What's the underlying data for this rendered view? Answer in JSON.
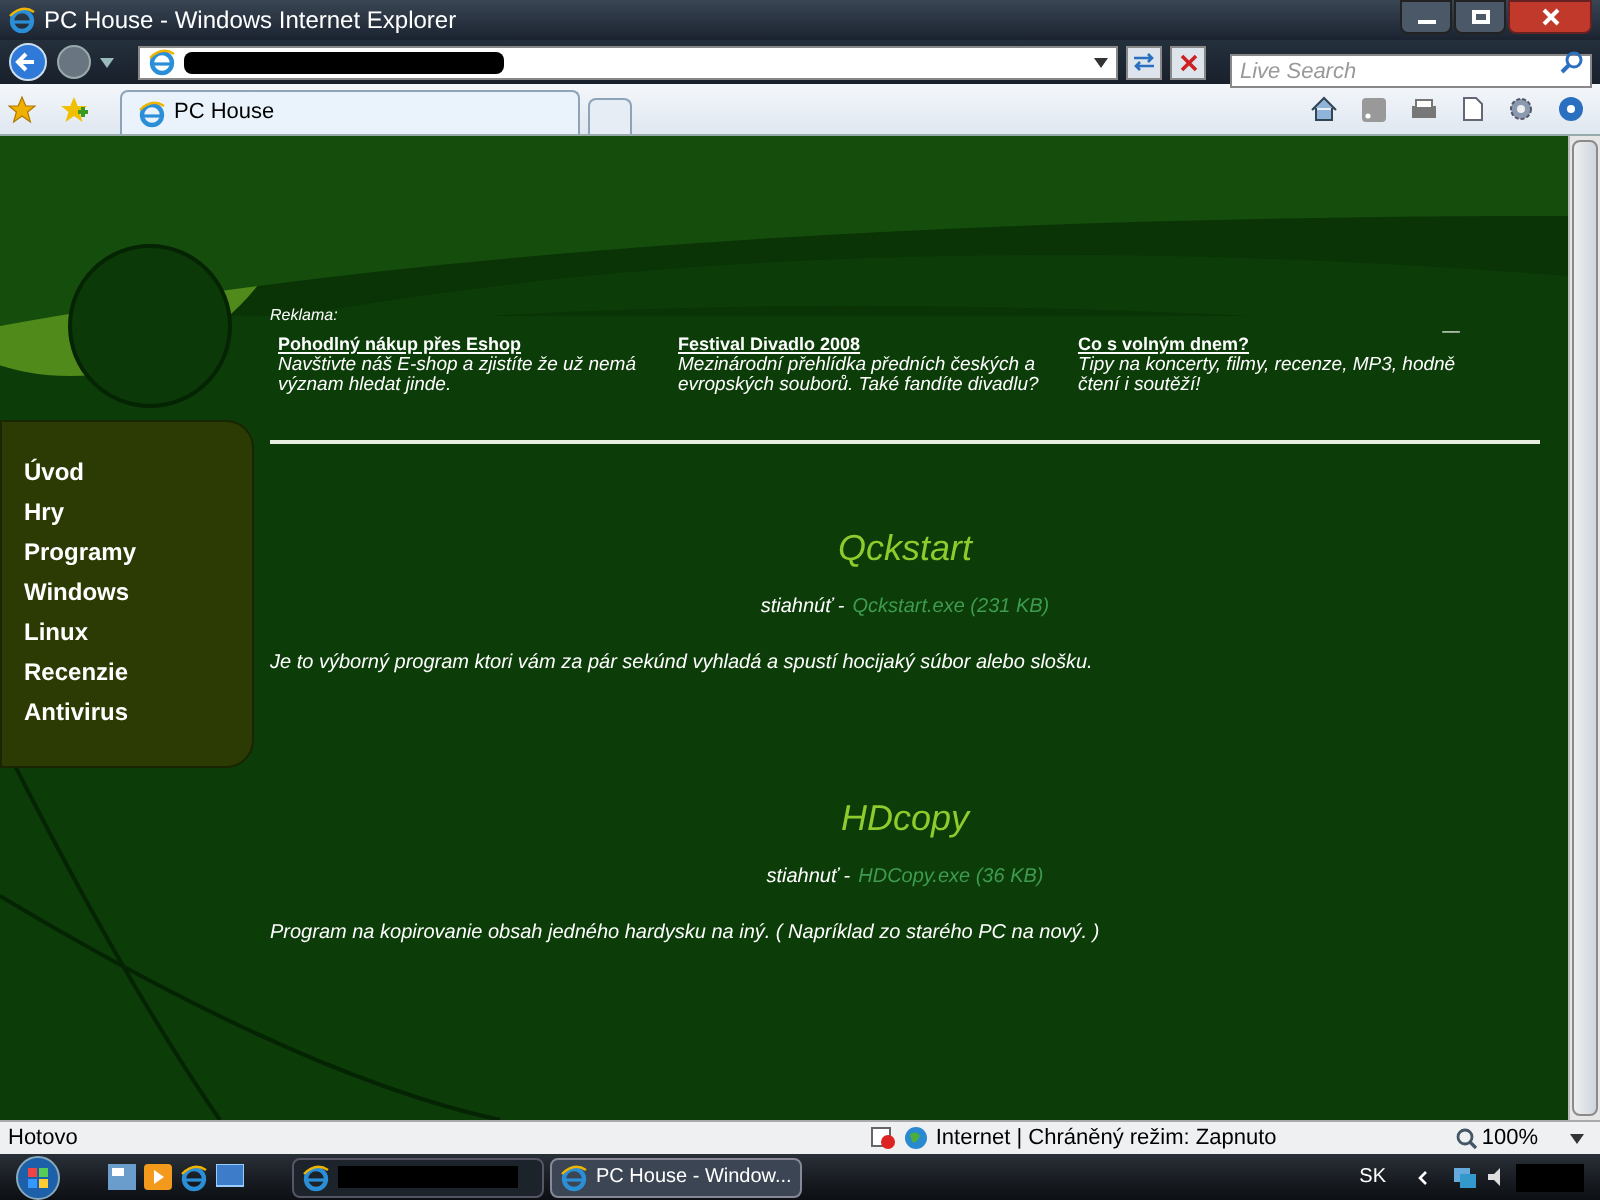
{
  "window": {
    "title": "PC House - Windows Internet Explorer"
  },
  "search": {
    "placeholder": "Live Search"
  },
  "tabs": [
    {
      "label": "PC House",
      "selected": true
    }
  ],
  "ads": {
    "label": "Reklama:",
    "mark": "––",
    "items": [
      {
        "title": "Pohodlný nákup přes Eshop",
        "text": "Navštivte náš E-shop a zjistíte že už nemá význam hledat jinde."
      },
      {
        "title": "Festival Divadlo 2008",
        "text": "Mezinárodní přehlídka předních českých a evropských souborů. Také fandíte divadlu?"
      },
      {
        "title": "Co s volným dnem?",
        "text": "Tipy na koncerty, filmy, recenze, MP3, hodně čtení i soutěží!"
      }
    ]
  },
  "nav": [
    {
      "label": "Úvod"
    },
    {
      "label": "Hry"
    },
    {
      "label": "Programy"
    },
    {
      "label": "Windows"
    },
    {
      "label": "Linux"
    },
    {
      "label": "Recenzie"
    },
    {
      "label": "Antivirus"
    }
  ],
  "programs": [
    {
      "name": "Qckstart",
      "download_label": "stiahnúť -",
      "link": "Qckstart.exe (231 KB)",
      "description": "Je to výborný program ktori vám za pár sekúnd vyhladá a spustí hocijaký súbor alebo slošku."
    },
    {
      "name": "HDcopy",
      "download_label": "stiahnuť -",
      "link": "HDCopy.exe (36 KB)",
      "description": "Program na kopirovanie obsah jedného hardysku na iný. ( Napríklad zo starého PC na nový. )"
    }
  ],
  "status_bar": {
    "text": "Hotovo",
    "zone": "Internet | Chráněný režim: Zapnuto",
    "zoom": "100%"
  },
  "taskbar": {
    "items": [
      {
        "kind": "redacted",
        "selected": false
      },
      {
        "kind": "app",
        "label": "PC House - Window...",
        "selected": true
      }
    ],
    "language": "SK"
  }
}
